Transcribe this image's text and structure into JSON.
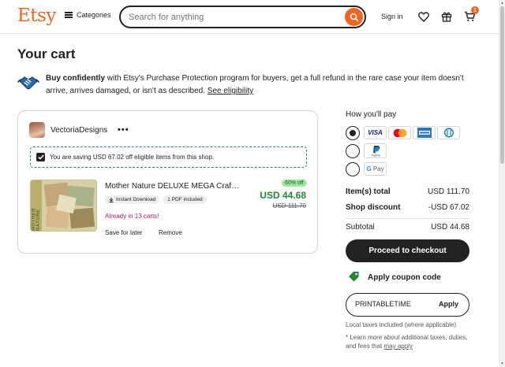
{
  "header": {
    "logo": "Etsy",
    "categories_label": "Categories",
    "search_placeholder": "Search for anything",
    "signin_label": "Sign in",
    "cart_count": "1",
    "brand_color": "#f1641e"
  },
  "page": {
    "title": "Your cart"
  },
  "protection": {
    "bold": "Buy confidently",
    "text": " with Etsy's Purchase Protection program for buyers, get a full refund in the rare case your item doesn't arrive, arrives damaged, or isn't as described. ",
    "link": "See eligibility"
  },
  "shop": {
    "name": "VectoriaDesigns",
    "more_label": "•••",
    "saving_text": "You are saving USD 67.02 off eligible items from this shop.",
    "item": {
      "title": "Mother Nature DELUXE MEGA Craft Kit",
      "thumb_label": "MOTHER NATURE",
      "badge_download": "Instant Download",
      "badge_pdf": "1 PDF included",
      "already_text": "Already in 13 carts!",
      "save_later_label": "Save for later",
      "remove_label": "Remove",
      "discount_label": "60% off",
      "price": "USD 44.68",
      "old_price": "USD 111.70",
      "price_color": "#258635"
    }
  },
  "payment": {
    "heading": "How you'll pay",
    "methods": [
      {
        "name": "cards",
        "cards": [
          "VISA",
          "Mastercard",
          "American Express",
          "Diners Club"
        ],
        "selected": true
      },
      {
        "name": "PayPal",
        "selected": false
      },
      {
        "name": "G Pay",
        "selected": false
      }
    ]
  },
  "summary": {
    "items_total_label": "Item(s) total",
    "items_total_value": "USD 111.70",
    "shop_discount_label": "Shop discount",
    "shop_discount_value": "-USD 67.02",
    "subtotal_label": "Subtotal",
    "subtotal_value": "USD 44.68",
    "checkout_label": "Proceed to checkout",
    "coupon_label": "Apply coupon code",
    "coupon_value": "PRINTABLETIME",
    "apply_label": "Apply",
    "tax_note": "Local taxes included (where applicable)",
    "learn_more_text": "* Learn more about additional taxes, duties, and fees that ",
    "learn_more_link": "may apply"
  }
}
